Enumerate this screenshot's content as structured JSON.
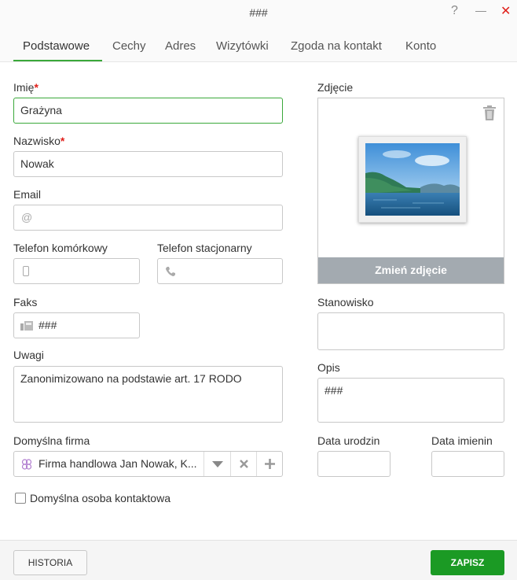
{
  "window": {
    "title": "###",
    "help": "?",
    "minimize": "—",
    "close": "✕"
  },
  "tabs": [
    {
      "label": "Podstawowe"
    },
    {
      "label": "Cechy"
    },
    {
      "label": "Adres"
    },
    {
      "label": "Wizytówki"
    },
    {
      "label": "Zgoda na kontakt"
    },
    {
      "label": "Konto"
    }
  ],
  "form": {
    "first_name": {
      "label": "Imię",
      "required": "*",
      "value": "Grażyna"
    },
    "last_name": {
      "label": "Nazwisko",
      "required": "*",
      "value": "Nowak"
    },
    "email": {
      "label": "Email",
      "icon": "@",
      "value": ""
    },
    "mobile": {
      "label": "Telefon komórkowy",
      "value": ""
    },
    "landline": {
      "label": "Telefon stacjonarny",
      "value": ""
    },
    "fax": {
      "label": "Faks",
      "value": "###"
    },
    "notes": {
      "label": "Uwagi",
      "value": "Zanonimizowano na podstawie art. 17 RODO"
    },
    "company": {
      "label": "Domyślna firma",
      "value": "Firma handlowa Jan Nowak, K..."
    },
    "default_contact": {
      "label": "Domyślna osoba kontaktowa",
      "checked": false
    }
  },
  "photo": {
    "label": "Zdjęcie",
    "change_label": "Zmień zdjęcie"
  },
  "position": {
    "label": "Stanowisko",
    "value": ""
  },
  "description": {
    "label": "Opis",
    "value": "###"
  },
  "birth_date": {
    "label": "Data urodzin",
    "value": ""
  },
  "name_day": {
    "label": "Data imienin",
    "value": ""
  },
  "footer": {
    "history_label": "HISTORIA",
    "save_label": "ZAPISZ"
  },
  "colors": {
    "accent": "#3aa83a",
    "save_button": "#1b9a24",
    "required": "#e0201b",
    "photo_button": "#a3aab0"
  }
}
